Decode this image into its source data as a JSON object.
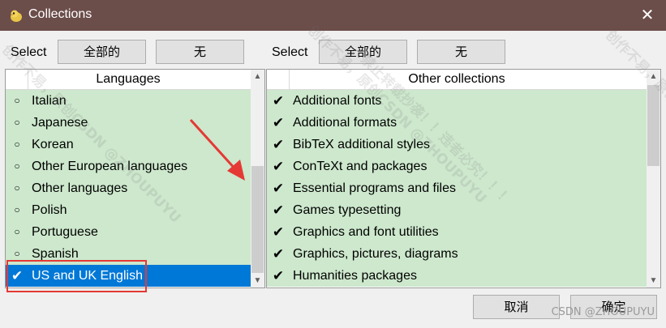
{
  "window": {
    "title": "Collections",
    "close_glyph": "✕"
  },
  "left": {
    "select_label": "Select",
    "all_button": "全部的",
    "none_button": "无",
    "header": "Languages",
    "items": [
      {
        "label": "Italian",
        "checked": false,
        "selected": false
      },
      {
        "label": "Japanese",
        "checked": false,
        "selected": false
      },
      {
        "label": "Korean",
        "checked": false,
        "selected": false
      },
      {
        "label": "Other European languages",
        "checked": false,
        "selected": false
      },
      {
        "label": "Other languages",
        "checked": false,
        "selected": false
      },
      {
        "label": "Polish",
        "checked": false,
        "selected": false
      },
      {
        "label": "Portuguese",
        "checked": false,
        "selected": false
      },
      {
        "label": "Spanish",
        "checked": false,
        "selected": false
      },
      {
        "label": "US and UK English",
        "checked": true,
        "selected": true
      }
    ]
  },
  "right": {
    "select_label": "Select",
    "all_button": "全部的",
    "none_button": "无",
    "header": "Other collections",
    "items": [
      {
        "label": "Additional fonts",
        "checked": true,
        "selected": false
      },
      {
        "label": "Additional formats",
        "checked": true,
        "selected": false
      },
      {
        "label": "BibTeX additional styles",
        "checked": true,
        "selected": false
      },
      {
        "label": "ConTeXt and packages",
        "checked": true,
        "selected": false
      },
      {
        "label": "Essential programs and files",
        "checked": true,
        "selected": false
      },
      {
        "label": "Games typesetting",
        "checked": true,
        "selected": false
      },
      {
        "label": "Graphics and font utilities",
        "checked": true,
        "selected": false
      },
      {
        "label": "Graphics, pictures, diagrams",
        "checked": true,
        "selected": false
      },
      {
        "label": "Humanities packages",
        "checked": true,
        "selected": false
      }
    ]
  },
  "footer": {
    "cancel_button": "取消",
    "ok_button": "确定"
  },
  "watermark": {
    "line1": "创作不易，原创CSDN @ZHOUPUYU",
    "line2": "禁止转载抄袭！！违者必究！！！",
    "corner": "CSDN @ZHOUPUYU"
  },
  "colors": {
    "titlebar": "#6b4d4a",
    "list_bg": "#cde8cd",
    "selection": "#0078d7",
    "annotation": "#e53935"
  }
}
